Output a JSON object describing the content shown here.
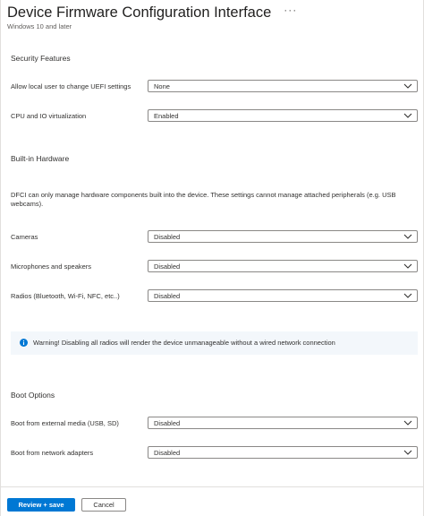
{
  "header": {
    "title": "Device Firmware Configuration Interface",
    "more": "···",
    "subtitle": "Windows 10 and later"
  },
  "security": {
    "title": "Security Features",
    "fields": [
      {
        "label": "Allow local user to change UEFI settings",
        "value": "None"
      },
      {
        "label": "CPU and IO virtualization",
        "value": "Enabled"
      }
    ]
  },
  "hardware": {
    "title": "Built-in Hardware",
    "description": "DFCI can only manage hardware components built into the device. These settings cannot manage attached peripherals (e.g. USB webcams).",
    "fields": [
      {
        "label": "Cameras",
        "value": "Disabled"
      },
      {
        "label": "Microphones and speakers",
        "value": "Disabled"
      },
      {
        "label": "Radios (Bluetooth, Wi-Fi, NFC, etc..)",
        "value": "Disabled"
      }
    ],
    "warning": "Warning! Disabling all radios will render the device unmanageable without a wired network connection"
  },
  "boot": {
    "title": "Boot Options",
    "fields": [
      {
        "label": "Boot from external media (USB, SD)",
        "value": "Disabled"
      },
      {
        "label": "Boot from network adapters",
        "value": "Disabled"
      }
    ]
  },
  "footer": {
    "primary_label": "Review + save",
    "secondary_label": "Cancel"
  },
  "colors": {
    "accent": "#0078d4",
    "info_background": "#f3f7fb",
    "border": "#8a8886"
  }
}
